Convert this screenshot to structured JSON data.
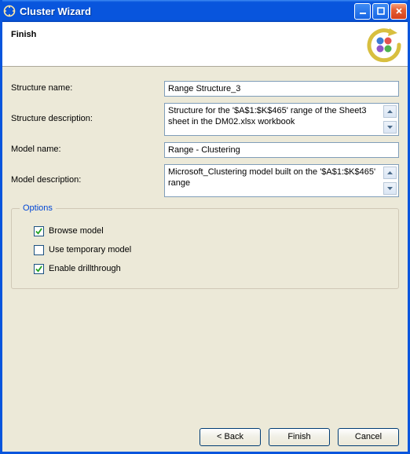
{
  "window": {
    "title": "Cluster Wizard"
  },
  "header": {
    "page_title": "Finish"
  },
  "form": {
    "structure_name_label": "Structure name:",
    "structure_name_value": "Range Structure_3",
    "structure_desc_label": "Structure description:",
    "structure_desc_value": "Structure for the '$A$1:$K$465' range of the Sheet3 sheet in the DM02.xlsx workbook",
    "model_name_label": "Model name:",
    "model_name_value": "Range - Clustering",
    "model_desc_label": "Model description:",
    "model_desc_value": "Microsoft_Clustering model built on the '$A$1:$K$465' range"
  },
  "options": {
    "legend": "Options",
    "browse_model": {
      "label": "Browse model",
      "checked": true
    },
    "use_temp": {
      "label": "Use temporary model",
      "checked": false
    },
    "drillthrough": {
      "label": "Enable drillthrough",
      "checked": true
    }
  },
  "buttons": {
    "back": "< Back",
    "finish": "Finish",
    "cancel": "Cancel"
  }
}
